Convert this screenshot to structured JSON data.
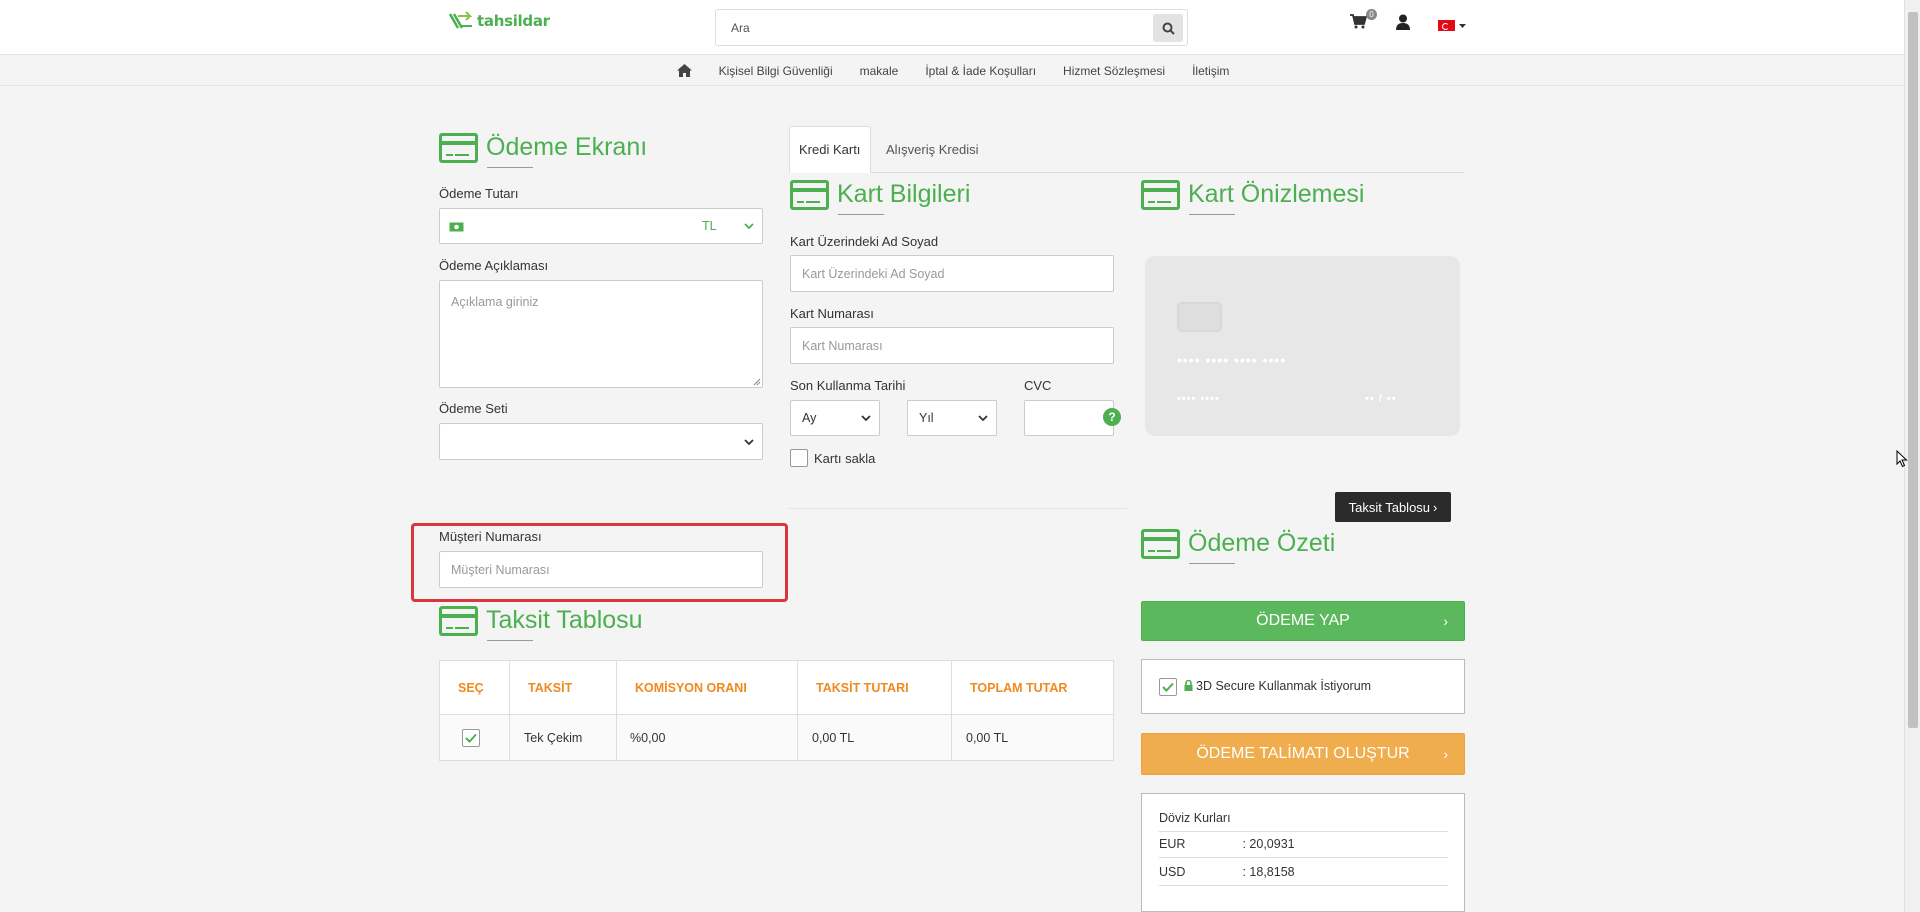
{
  "header": {
    "logo_text": "tahsildar",
    "search_placeholder": "Ara",
    "cart_count": "0"
  },
  "nav": {
    "items": [
      "Kişisel Bilgi Güvenliği",
      "makale",
      "İptal & İade Koşulları",
      "Hizmet Sözleşmesi",
      "İletişim"
    ]
  },
  "payment": {
    "title": "Ödeme Ekranı",
    "amount_label": "Ödeme Tutarı",
    "currency": "TL",
    "desc_label": "Ödeme Açıklaması",
    "desc_placeholder": "Açıklama giriniz",
    "set_label": "Ödeme Seti"
  },
  "tabs": [
    "Kredi Kartı",
    "Alışveriş Kredisi"
  ],
  "card": {
    "title": "Kart Bilgileri",
    "name_label": "Kart Üzerindeki Ad Soyad",
    "name_placeholder": "Kart Üzerindeki Ad Soyad",
    "number_label": "Kart Numarası",
    "number_placeholder": "Kart Numarası",
    "expiry_label": "Son Kullanma Tarihi",
    "month_placeholder": "Ay",
    "year_placeholder": "Yıl",
    "cvc_label": "CVC",
    "save_label": "Kartı sakla"
  },
  "preview": {
    "title": "Kart Önizlemesi",
    "number_mask": "•••• •••• •••• ••••",
    "name_mask": "•••• ••••",
    "expiry_mask": "•• / ••",
    "installment_button": "Taksit Tablosu"
  },
  "customer": {
    "label": "Müşteri Numarası",
    "placeholder": "Müşteri Numarası"
  },
  "installments": {
    "title": "Taksit Tablosu",
    "headers": [
      "SEÇ",
      "TAKSİT",
      "KOMİSYON ORANI",
      "TAKSİT TUTARI",
      "TOPLAM TUTAR"
    ],
    "rows": [
      {
        "selected": true,
        "taksit": "Tek Çekim",
        "komisyon": "%0,00",
        "taksit_tutari": "0,00 TL",
        "toplam": "0,00 TL"
      }
    ]
  },
  "summary": {
    "title": "Ödeme Özeti",
    "pay_button": "ÖDEME YAP",
    "secure_label": "3D Secure Kullanmak İstiyorum",
    "order_button": "ÖDEME TALİMATI OLUŞTUR",
    "fx_title": "Döviz Kurları",
    "fx": [
      {
        "code": "EUR",
        "rate": ": 20,0931"
      },
      {
        "code": "USD",
        "rate": ": 18,8158"
      }
    ]
  },
  "colors": {
    "brand_green": "#4caf50",
    "button_green": "#5cb85c",
    "button_orange": "#f0ad4e",
    "table_header": "#f0891e",
    "highlight_red": "#d9363e"
  }
}
